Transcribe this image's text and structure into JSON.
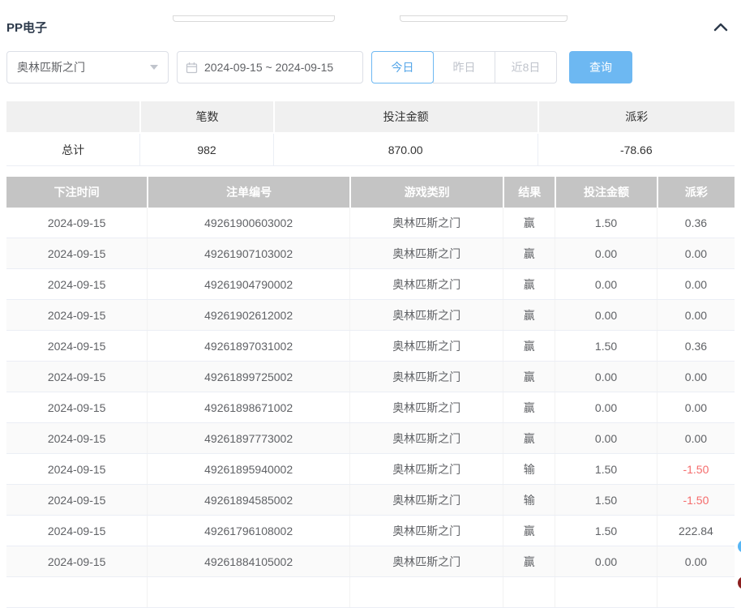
{
  "panel": {
    "title": "PP电子"
  },
  "filters": {
    "game_select": {
      "value": "奥林匹斯之门"
    },
    "date_range": {
      "value": "2024-09-15 ~ 2024-09-15"
    },
    "quick_buttons": [
      {
        "label": "今日",
        "active": true
      },
      {
        "label": "昨日",
        "active": false
      },
      {
        "label": "近8日",
        "active": false
      }
    ],
    "search_label": "查询"
  },
  "summary": {
    "headers": [
      "",
      "笔数",
      "投注金额",
      "派彩"
    ],
    "total": {
      "label": "总计",
      "count": "982",
      "bet_amount": "870.00",
      "payout": "-78.66"
    }
  },
  "table": {
    "headers": [
      "下注时间",
      "注单编号",
      "游戏类别",
      "结果",
      "投注金额",
      "派彩"
    ],
    "rows": [
      [
        "2024-09-15",
        "49261900603002",
        "奥林匹斯之门",
        "赢",
        "1.50",
        "0.36"
      ],
      [
        "2024-09-15",
        "49261907103002",
        "奥林匹斯之门",
        "赢",
        "0.00",
        "0.00"
      ],
      [
        "2024-09-15",
        "49261904790002",
        "奥林匹斯之门",
        "赢",
        "0.00",
        "0.00"
      ],
      [
        "2024-09-15",
        "49261902612002",
        "奥林匹斯之门",
        "赢",
        "0.00",
        "0.00"
      ],
      [
        "2024-09-15",
        "49261897031002",
        "奥林匹斯之门",
        "赢",
        "1.50",
        "0.36"
      ],
      [
        "2024-09-15",
        "49261899725002",
        "奥林匹斯之门",
        "赢",
        "0.00",
        "0.00"
      ],
      [
        "2024-09-15",
        "49261898671002",
        "奥林匹斯之门",
        "赢",
        "0.00",
        "0.00"
      ],
      [
        "2024-09-15",
        "49261897773002",
        "奥林匹斯之门",
        "赢",
        "0.00",
        "0.00"
      ],
      [
        "2024-09-15",
        "49261895940002",
        "奥林匹斯之门",
        "输",
        "1.50",
        "-1.50"
      ],
      [
        "2024-09-15",
        "49261894585002",
        "奥林匹斯之门",
        "输",
        "1.50",
        "-1.50"
      ],
      [
        "2024-09-15",
        "49261796108002",
        "奥林匹斯之门",
        "赢",
        "1.50",
        "222.84"
      ],
      [
        "2024-09-15",
        "49261884105002",
        "奥林匹斯之门",
        "赢",
        "0.00",
        "0.00"
      ]
    ]
  },
  "icons": {
    "collapse": "chevron-up-icon",
    "date": "calendar-icon",
    "select": "caret-down-icon"
  },
  "colors": {
    "accent_blue": "#6db8f2",
    "negative_red": "#f56c6c",
    "table_header_gray": "#c4c4c4",
    "summary_header_gray": "#f0f0f0"
  }
}
